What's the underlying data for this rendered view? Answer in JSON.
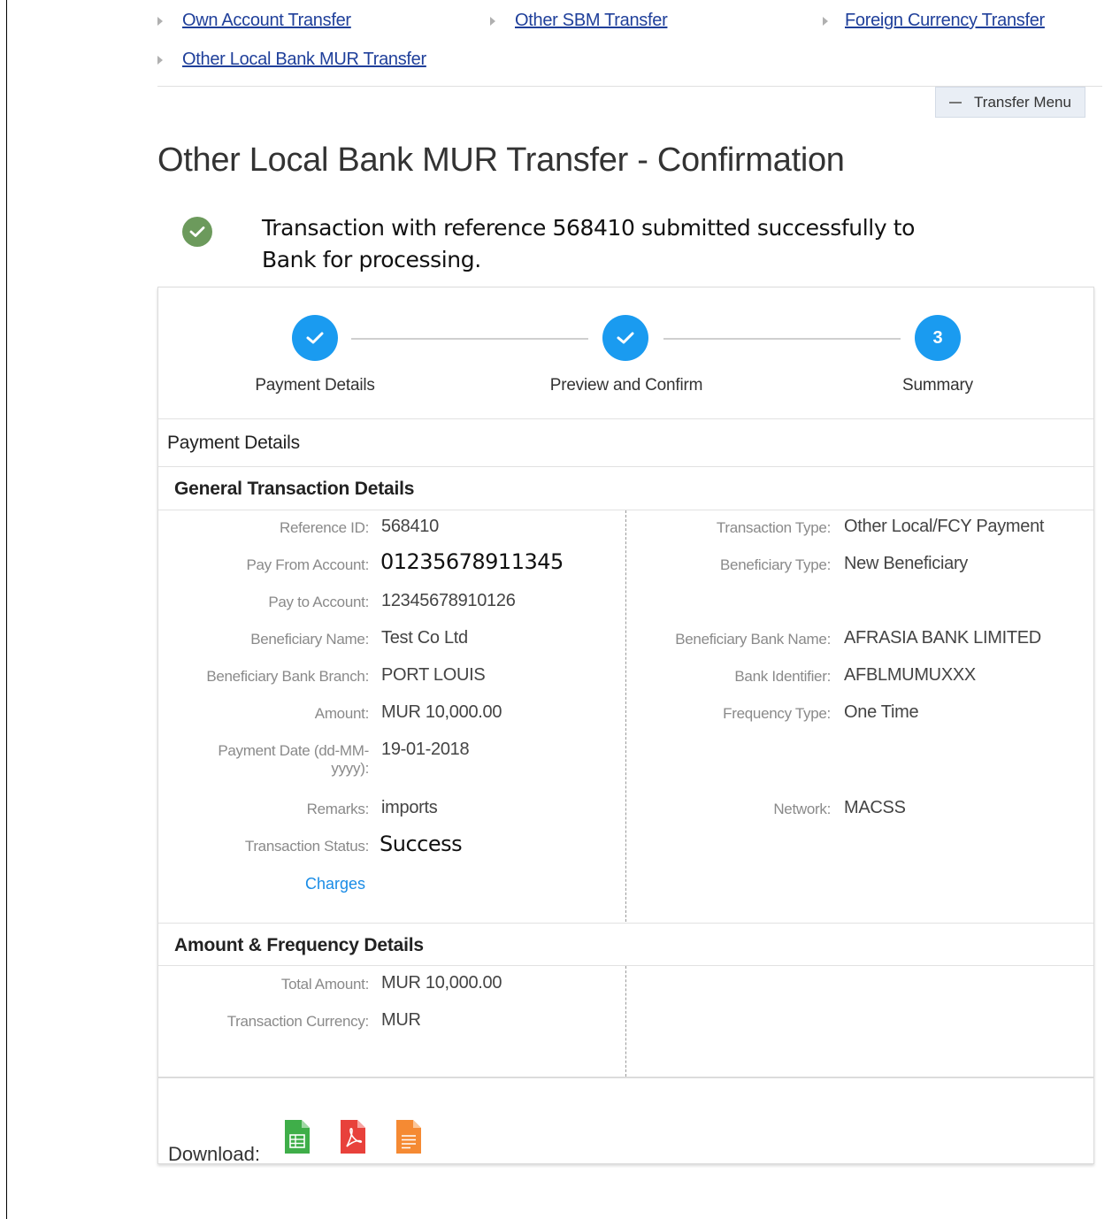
{
  "quick_links": [
    {
      "label": "Own Account Transfer"
    },
    {
      "label": "Other SBM Transfer"
    },
    {
      "label": "Foreign Currency Transfer"
    },
    {
      "label": "Other Local Bank MUR Transfer"
    }
  ],
  "transfer_menu_label": "Transfer Menu",
  "page_title": "Other Local Bank MUR Transfer - Confirmation",
  "success_message": "Transaction with reference 568410 submitted successfully to Bank for processing.",
  "steps": [
    {
      "label": "Payment Details",
      "state": "done"
    },
    {
      "label": "Preview and Confirm",
      "state": "done"
    },
    {
      "label": "Summary",
      "state": "current",
      "number": "3"
    }
  ],
  "payment_details_title": "Payment Details",
  "general": {
    "title": "General Transaction Details",
    "left": [
      {
        "label": "Reference ID:",
        "value": "568410"
      },
      {
        "label": "Pay From Account:",
        "value": "01235678911345"
      },
      {
        "label": "Pay to Account:",
        "value": "12345678910126"
      },
      {
        "label": "Beneficiary Name:",
        "value": "Test Co Ltd"
      },
      {
        "label": "Beneficiary Bank Branch:",
        "value": "PORT LOUIS"
      },
      {
        "label": "Amount:",
        "value": "MUR 10,000.00"
      },
      {
        "label": "Payment Date (dd-MM-yyyy):",
        "value": "19-01-2018"
      },
      {
        "label": "Remarks:",
        "value": "imports"
      },
      {
        "label": "Transaction Status:",
        "value": "Success"
      }
    ],
    "right": [
      {
        "label": "Transaction Type:",
        "value": "Other Local/FCY Payment"
      },
      {
        "label": "Beneficiary Type:",
        "value": "New Beneficiary"
      },
      {
        "label": "Beneficiary Bank Name:",
        "value": "AFRASIA BANK LIMITED"
      },
      {
        "label": "Bank Identifier:",
        "value": "AFBLMUMUXXX"
      },
      {
        "label": "Frequency Type:",
        "value": "One Time"
      },
      {
        "label": "Network:",
        "value": "MACSS"
      }
    ],
    "charges_link": "Charges"
  },
  "amount_freq": {
    "title": "Amount & Frequency Details",
    "rows": [
      {
        "label": "Total Amount:",
        "value": "MUR 10,000.00"
      },
      {
        "label": "Transaction Currency:",
        "value": "MUR"
      }
    ]
  },
  "download_label": "Download:",
  "download_icons": [
    "excel-icon",
    "pdf-icon",
    "text-file-icon"
  ],
  "colors": {
    "link": "#1f3f9a",
    "accent": "#1a9bf0",
    "success": "#6c9a5c",
    "excel": "#3fae49",
    "pdf": "#e8413b",
    "text": "#f58a33"
  }
}
